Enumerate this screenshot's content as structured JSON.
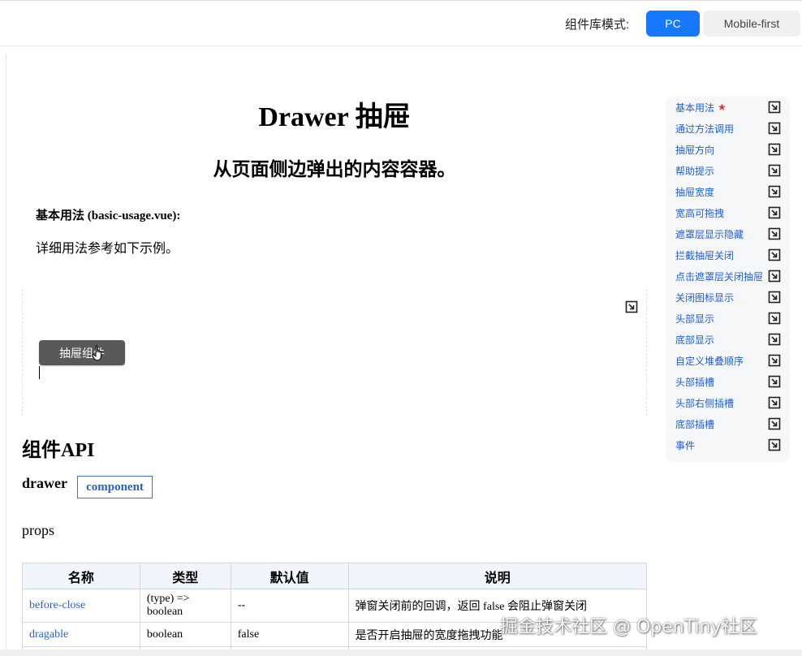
{
  "topbar": {
    "mode_label": "组件库模式:",
    "mode_pc": "PC",
    "mode_mobile": "Mobile-first"
  },
  "page": {
    "title": "Drawer 抽屉",
    "subtitle": "从页面侧边弹出的内容容器。"
  },
  "section": {
    "title": "基本用法 (basic-usage.vue):",
    "description": "详细用法参考如下示例。"
  },
  "demo": {
    "button_label": "抽屉组件"
  },
  "api": {
    "title": "组件API",
    "component_name": "drawer",
    "component_badge": "component",
    "props_label": "props",
    "table": {
      "headers": [
        "名称",
        "类型",
        "默认值",
        "说明"
      ],
      "rows": [
        {
          "name": "before-close",
          "type": "(type) => boolean",
          "default": "--",
          "desc": "弹窗关闭前的回调，返回 false 会阻止弹窗关闭"
        },
        {
          "name": "dragable",
          "type": "boolean",
          "default": "false",
          "desc": "是否开启抽屉的宽度拖拽功能"
        }
      ]
    }
  },
  "sidenav": {
    "items": [
      {
        "label": "基本用法",
        "starred": true
      },
      {
        "label": "通过方法调用"
      },
      {
        "label": "抽屉方向"
      },
      {
        "label": "帮助提示"
      },
      {
        "label": "抽屉宽度"
      },
      {
        "label": "宽高可拖拽"
      },
      {
        "label": "遮罩层显示隐藏"
      },
      {
        "label": "拦截抽屉关闭"
      },
      {
        "label": "点击遮罩层关闭抽屉"
      },
      {
        "label": "关闭图标显示"
      },
      {
        "label": "头部显示"
      },
      {
        "label": "底部显示"
      },
      {
        "label": "自定义堆叠顺序"
      },
      {
        "label": "头部插槽"
      },
      {
        "label": "头部右侧插槽"
      },
      {
        "label": "底部插槽"
      },
      {
        "label": "事件"
      }
    ]
  },
  "watermark": "掘金技术社区 @ OpenTiny社区",
  "colors": {
    "accent": "#1677ff",
    "link": "#1f5fcf",
    "star": "#e8333a",
    "demo_button": "#595959"
  }
}
